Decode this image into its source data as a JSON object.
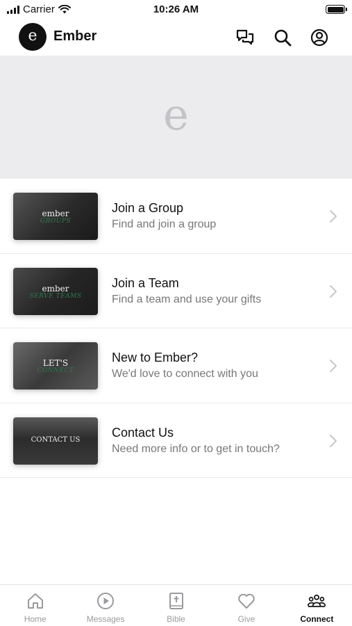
{
  "status_bar": {
    "carrier": "Carrier",
    "time": "10:26 AM"
  },
  "header": {
    "logo_glyph": "e",
    "title": "Ember"
  },
  "hero": {
    "glyph": "e"
  },
  "items": [
    {
      "title": "Join a Group",
      "subtitle": "Find and join a group",
      "thumb_text": "ember",
      "thumb_sub": "GROUPS",
      "thumb_color": "#3a3a3a"
    },
    {
      "title": "Join a Team",
      "subtitle": "Find a team and use your gifts",
      "thumb_text": "ember",
      "thumb_sub": "SERVE TEAMS",
      "thumb_color": "#2e2e2e"
    },
    {
      "title": "New to Ember?",
      "subtitle": "We'd love to connect with you",
      "thumb_text": "LET'S",
      "thumb_sub": "CONNECT",
      "thumb_color": "#4a4a4a"
    },
    {
      "title": "Contact Us",
      "subtitle": "Need more info or to get in touch?",
      "thumb_text": "CONTACT US",
      "thumb_sub": "",
      "thumb_color": "#3c3c3c"
    }
  ],
  "tabs": [
    {
      "label": "Home",
      "icon": "home-icon"
    },
    {
      "label": "Messages",
      "icon": "play-icon"
    },
    {
      "label": "Bible",
      "icon": "bible-icon"
    },
    {
      "label": "Give",
      "icon": "heart-icon"
    },
    {
      "label": "Connect",
      "icon": "people-icon",
      "active": true
    }
  ],
  "colors": {
    "accent": "#111111",
    "inactive": "#9a9a9e",
    "hero_bg": "#ececee"
  }
}
